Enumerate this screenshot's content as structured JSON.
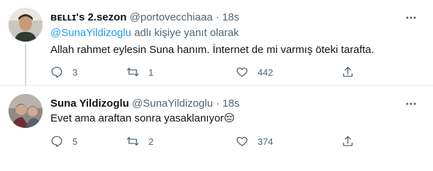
{
  "tweets": [
    {
      "display_name": "ʙᴇʟʟɪ's 2.sezon",
      "handle": "@portovecchiaaa",
      "separator": "·",
      "time": "18s",
      "reply_prefix": "",
      "reply_mention": "@SunaYildizoglu",
      "reply_suffix": " adlı kişiye yanıt olarak",
      "text": "Allah rahmet eylesin Suna hanım. İnternet de mi varmış öteki tarafta.",
      "reply_count": "3",
      "retweet_count": "1",
      "like_count": "442",
      "share_count": ""
    },
    {
      "display_name": "Suna Yildizoglu",
      "handle": "@SunaYildizoglu",
      "separator": "·",
      "time": "18s",
      "text": "Evet ama araftan sonra yasaklanıyor",
      "emoji": "😔",
      "reply_count": "5",
      "retweet_count": "2",
      "like_count": "374",
      "share_count": ""
    }
  ],
  "colors": {
    "accent": "#1d9bf0",
    "muted": "#536471",
    "text": "#0f1419"
  },
  "icons": [
    "more-icon",
    "reply-icon",
    "retweet-icon",
    "like-icon",
    "share-icon"
  ]
}
